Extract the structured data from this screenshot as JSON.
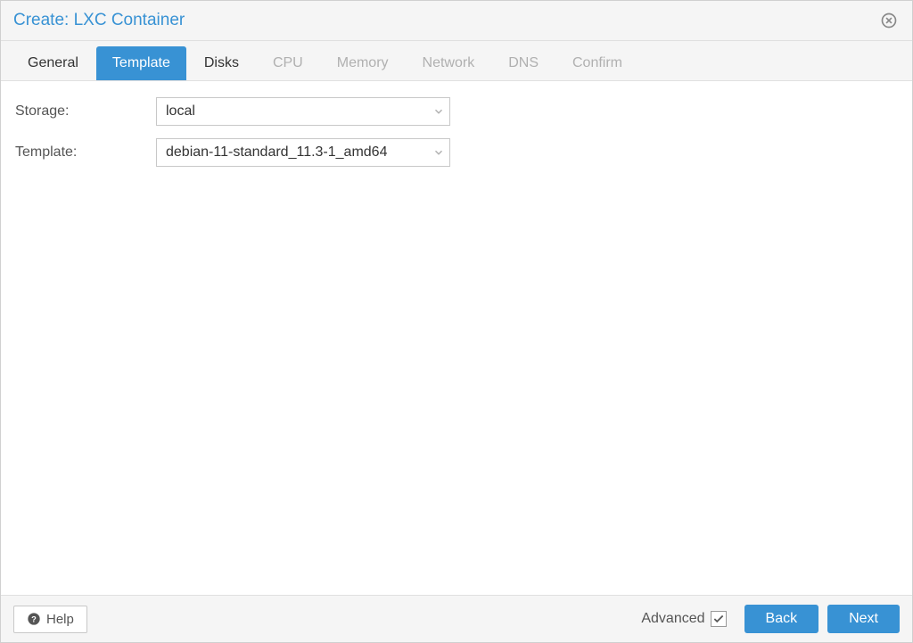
{
  "dialog": {
    "title": "Create: LXC Container"
  },
  "tabs": [
    {
      "label": "General",
      "state": "enabled"
    },
    {
      "label": "Template",
      "state": "active"
    },
    {
      "label": "Disks",
      "state": "enabled"
    },
    {
      "label": "CPU",
      "state": "disabled"
    },
    {
      "label": "Memory",
      "state": "disabled"
    },
    {
      "label": "Network",
      "state": "disabled"
    },
    {
      "label": "DNS",
      "state": "disabled"
    },
    {
      "label": "Confirm",
      "state": "disabled"
    }
  ],
  "form": {
    "storage": {
      "label": "Storage:",
      "value": "local"
    },
    "template": {
      "label": "Template:",
      "value": "debian-11-standard_11.3-1_amd64"
    }
  },
  "footer": {
    "help_label": "Help",
    "advanced_label": "Advanced",
    "advanced_checked": true,
    "back_label": "Back",
    "next_label": "Next"
  }
}
